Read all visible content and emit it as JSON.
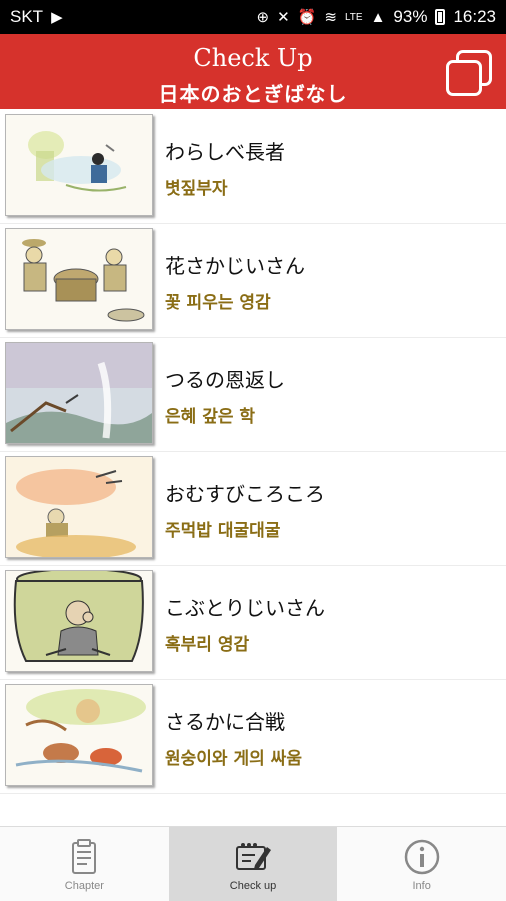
{
  "status_bar": {
    "carrier": "SKT",
    "network": "LTE",
    "battery": "93%",
    "time": "16:23",
    "icons": [
      "notification-icon",
      "sync-icon",
      "mute-icon",
      "alarm-icon",
      "wifi-calling-icon",
      "lte-icon",
      "signal-icon",
      "battery-icon"
    ]
  },
  "header": {
    "title": "Check Up",
    "subtitle": "日本のおとぎばなし",
    "action_icon": "window-switch-icon",
    "background": "#d6322c"
  },
  "stories": [
    {
      "jp": "わらしべ長者",
      "kr": "볏짚부자"
    },
    {
      "jp": "花さかじいさん",
      "kr": "꽃 피우는 영감"
    },
    {
      "jp": "つるの恩返し",
      "kr": "은혜 갚은 학"
    },
    {
      "jp": "おむすびころころ",
      "kr": "주먹밥 대굴대굴"
    },
    {
      "jp": "こぶとりじいさん",
      "kr": "혹부리 영감"
    },
    {
      "jp": "さるかに合戦",
      "kr": "원숭이와 게의 싸움"
    }
  ],
  "tabs": [
    {
      "label": "Chapter",
      "icon": "clipboard-icon",
      "active": false
    },
    {
      "label": "Check up",
      "icon": "edit-icon",
      "active": true
    },
    {
      "label": "Info",
      "icon": "info-icon",
      "active": false
    }
  ],
  "colors": {
    "header": "#d6322c",
    "korean_text": "#8a6d15",
    "active_tab": "#d9d9d9"
  }
}
